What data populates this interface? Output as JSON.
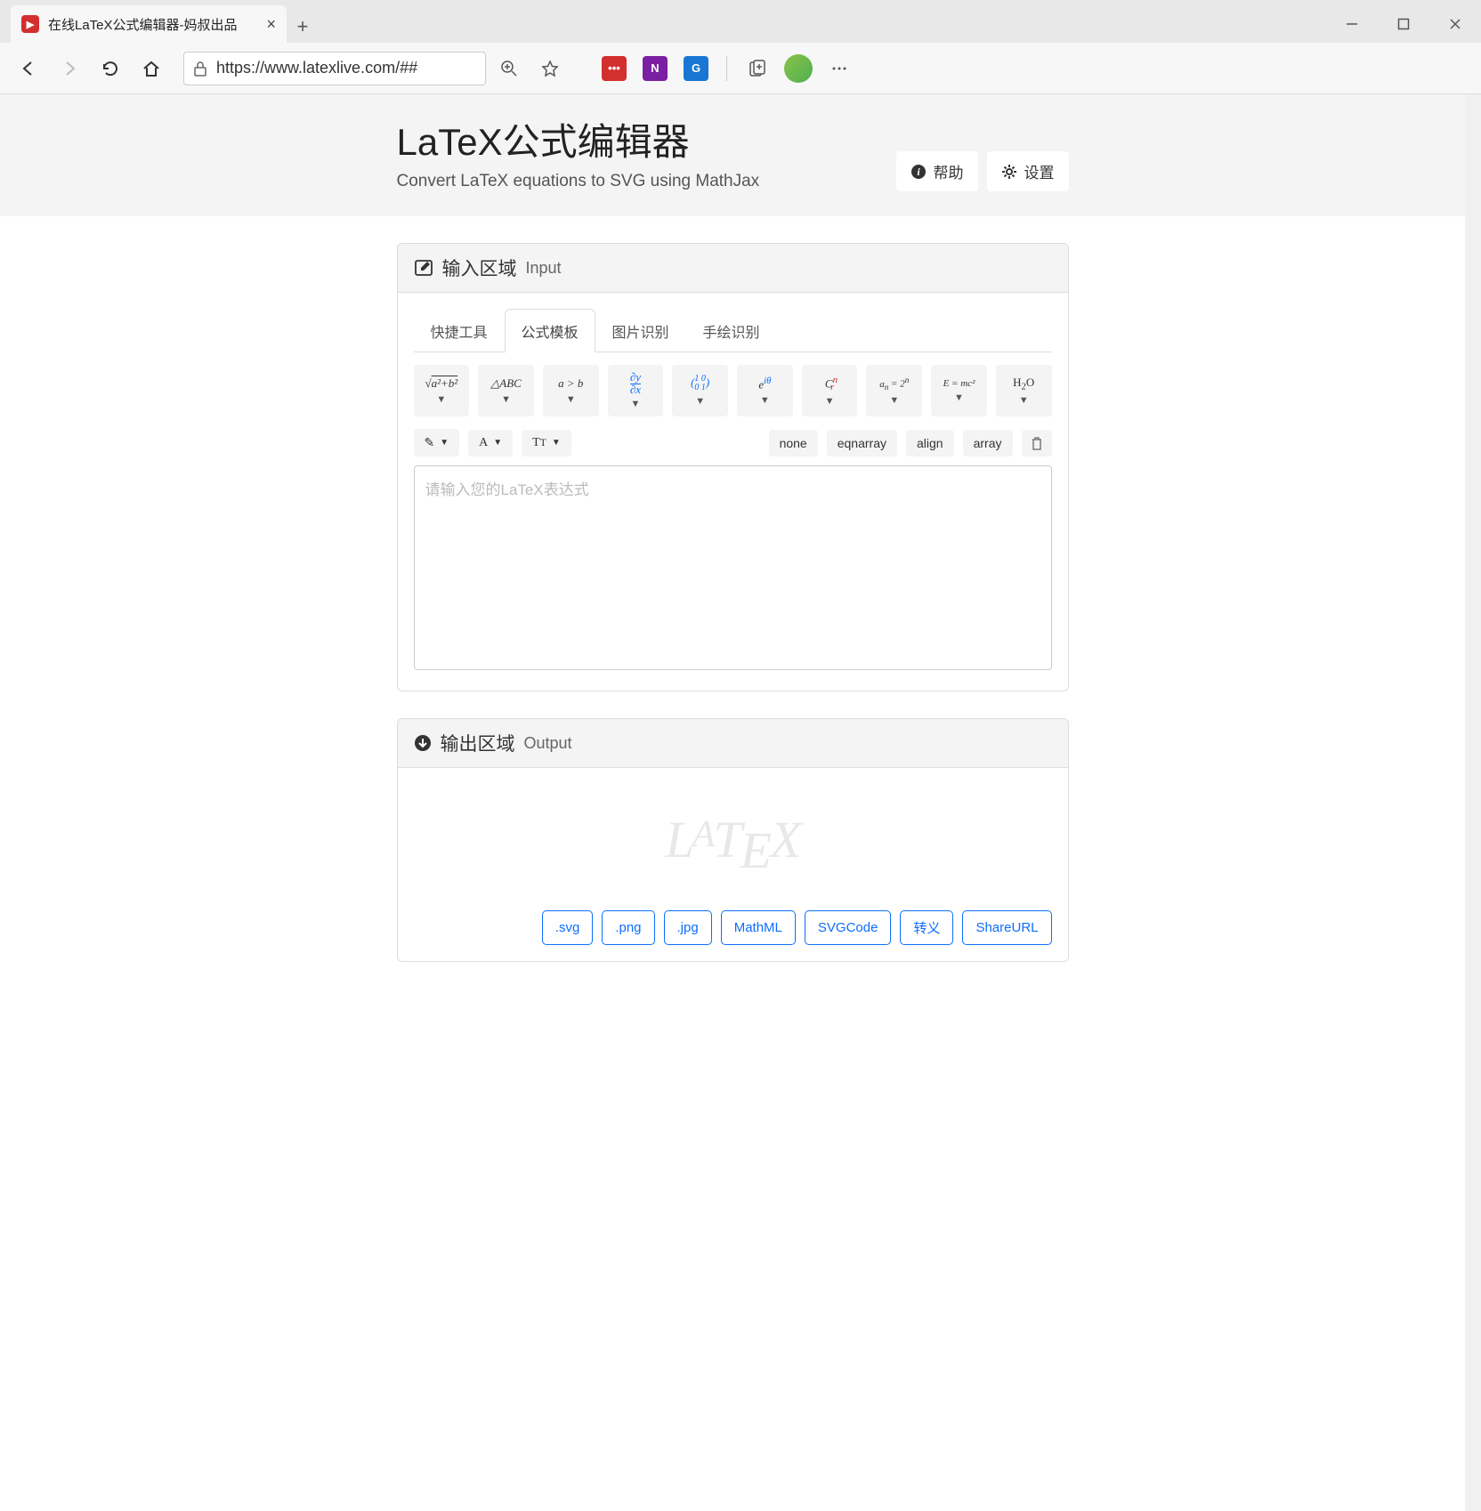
{
  "browser": {
    "tab_title": "在线LaTeX公式编辑器-妈叔出品",
    "url": "https://www.latexlive.com/##"
  },
  "header": {
    "title": "LaTeX公式编辑器",
    "subtitle": "Convert LaTeX equations to SVG using MathJax",
    "help": "帮助",
    "settings": "设置"
  },
  "input_panel": {
    "title": "输入区域",
    "title_sub": "Input",
    "tabs": [
      "快捷工具",
      "公式模板",
      "图片识别",
      "手绘识别"
    ],
    "active_tab": 1,
    "templates": [
      "√(a²+b²)",
      "△ABC",
      "a > b",
      "∂y/∂x",
      "(1 0; 0 1)",
      "eⁱᶿ",
      "Cⁿᵣ",
      "aₙ = 2ⁿ",
      "E = mc²",
      "H₂O"
    ],
    "format_buttons": [
      "none",
      "eqnarray",
      "align",
      "array"
    ],
    "placeholder": "请输入您的LaTeX表达式",
    "value": ""
  },
  "output_panel": {
    "title": "输出区域",
    "title_sub": "Output",
    "placeholder_logo": "LATEX",
    "exports": [
      ".svg",
      ".png",
      ".jpg",
      "MathML",
      "SVGCode",
      "转义",
      "ShareURL"
    ]
  }
}
